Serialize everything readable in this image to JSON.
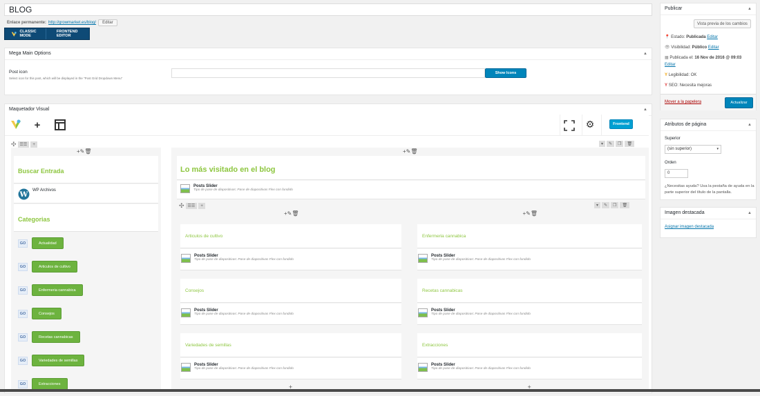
{
  "title": "BLOG",
  "permalink": {
    "label": "Enlace permanente:",
    "url": "http://growmarket.es/blog/",
    "edit": "Editar"
  },
  "modes": {
    "classic": "CLASSIC MODE",
    "frontend": "FRONTEND EDITOR"
  },
  "mega": {
    "title": "Mega Main Options",
    "post_icon_label": "Post icon",
    "post_icon_desc": "Select icon for this post, which will be displayed in the \"Post Grid Dropdown Menu\"",
    "show_icons": "Show Icons"
  },
  "maquetador": {
    "title": "Maquetador Visual",
    "frontend_btn": "Frontend"
  },
  "left_col": {
    "buscar": "Buscar Entrada",
    "wp_archivos": "WP Archivos",
    "categorias": "Categorias",
    "go": "GO",
    "categories": [
      "Actualidad",
      "Articulos de cultivo",
      "Enfermeria cannabica",
      "Consejos",
      "Recetas cannabicas",
      "Variedades de semillas",
      "Extracciones"
    ]
  },
  "right_col": {
    "heading": "Lo más visitado en el blog",
    "slider_title": "Posts Slider",
    "slider_sub": "Tipo de pase de diapositivas: Pase de diapositivas Flex con fundido",
    "left_sections": [
      "Articulos de cultivo",
      "Consejos",
      "Variedades de semillas"
    ],
    "right_sections": [
      "Enfermeria cannabica",
      "Recetas cannabicas",
      "Extracciones"
    ]
  },
  "publicar": {
    "title": "Publicar",
    "preview": "Vista previa de los cambios",
    "estado_label": "Estado:",
    "estado_value": "Publicada",
    "visibilidad_label": "Visibilidad:",
    "visibilidad_value": "Público",
    "publicada_label": "Publicada el:",
    "publicada_value": "16 Nov de 2016 @ 09:03",
    "legibilidad": "Legibilidad: OK",
    "seo": "SEO: Necesita mejoras",
    "edit": "Editar",
    "trash": "Mover a la papelera",
    "update": "Actualizar"
  },
  "atributos": {
    "title": "Atributos de página",
    "superior_label": "Superior",
    "superior_value": "(sin superior)",
    "orden_label": "Orden",
    "orden_value": "0",
    "help": "¿Necesitas ayuda? Usa la pestaña de ayuda en la parte superior del título de la pantalla."
  },
  "imagen": {
    "title": "Imagen destacada",
    "link": "Asignar imagen destacada"
  }
}
